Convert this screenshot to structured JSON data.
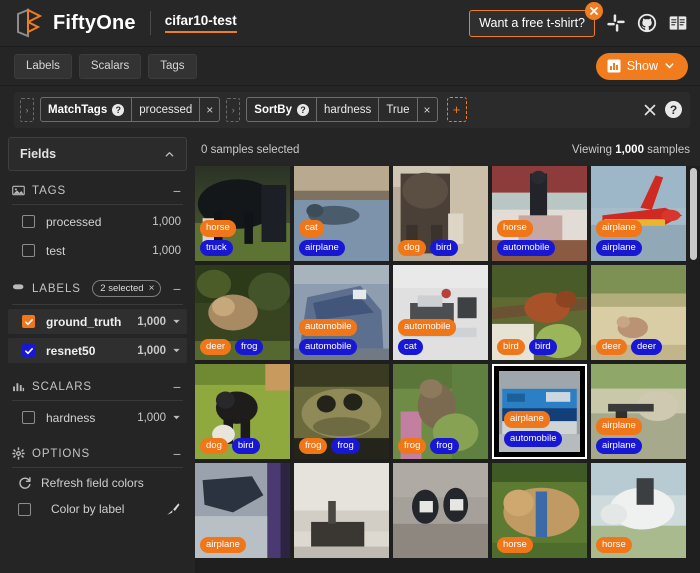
{
  "header": {
    "brand": "FiftyOne",
    "dataset_name": "cifar10-test",
    "tshirt_label": "Want a free t-shirt?",
    "icons": [
      "slack-icon",
      "github-icon",
      "docs-icon"
    ]
  },
  "tabs": [
    {
      "label": "Labels"
    },
    {
      "label": "Scalars"
    },
    {
      "label": "Tags"
    }
  ],
  "show_button": {
    "label": "Show"
  },
  "viewbar": {
    "stages": [
      {
        "name": "MatchTags",
        "help": "?",
        "parts": [
          "processed"
        ],
        "close": "×"
      },
      {
        "name": "SortBy",
        "help": "?",
        "parts": [
          "hardness",
          "True"
        ],
        "close": "×"
      }
    ],
    "add_label": "+",
    "clear_label": "×",
    "help_label": "?"
  },
  "sidebar": {
    "fields_label": "Fields",
    "sections": [
      {
        "name": "TAGS",
        "icon": "tags-icon",
        "collapse": "−",
        "items": [
          {
            "label": "processed",
            "count": "1,000",
            "checked": false,
            "color": "none",
            "caret": false
          },
          {
            "label": "test",
            "count": "1,000",
            "checked": false,
            "color": "none",
            "caret": false
          }
        ]
      },
      {
        "name": "LABELS",
        "icon": "labels-icon",
        "badge": "2 selected",
        "badge_close": "×",
        "collapse": "−",
        "items": [
          {
            "label": "ground_truth",
            "count": "1,000",
            "checked": true,
            "color": "orange",
            "caret": true
          },
          {
            "label": "resnet50",
            "count": "1,000",
            "checked": true,
            "color": "blue",
            "caret": true
          }
        ]
      },
      {
        "name": "SCALARS",
        "icon": "scalars-icon",
        "collapse": "−",
        "items": [
          {
            "label": "hardness",
            "count": "1,000",
            "checked": false,
            "color": "none",
            "caret": true
          }
        ]
      },
      {
        "name": "OPTIONS",
        "icon": "gear-icon",
        "collapse": "−",
        "options": [
          {
            "label": "Refresh field colors",
            "icon": "refresh-icon",
            "checkbox": false
          },
          {
            "label": "Color by label",
            "icon": "none",
            "checkbox": true,
            "trailing_icon": "brush-icon"
          }
        ]
      }
    ]
  },
  "samples_bar": {
    "selected_text": "0 samples selected",
    "viewing_prefix": "Viewing ",
    "viewing_count": "1,000",
    "viewing_suffix": " samples"
  },
  "colors": {
    "ground_truth": "#f0761a",
    "prediction": "#1818d4",
    "accent": "#ef7d22",
    "background": "#252525",
    "grid_background": "#1f1f1f"
  },
  "grid": {
    "columns": 5,
    "cells": [
      {
        "id": "r1c1",
        "gt": "horse",
        "pred": "truck",
        "layout": "stack",
        "selected": false,
        "img": {
          "base": "#2c3328",
          "style": "horse-dark"
        }
      },
      {
        "id": "r1c2",
        "gt": "cat",
        "pred": "airplane",
        "layout": "stack",
        "selected": false,
        "img": {
          "base": "#8d9fb2",
          "style": "cat-water"
        }
      },
      {
        "id": "r1c3",
        "gt": "dog",
        "pred": "bird",
        "layout": "row",
        "selected": false,
        "img": {
          "base": "#8a7b6c",
          "style": "dog-brown"
        }
      },
      {
        "id": "r1c4",
        "gt": "horse",
        "pred": "automobile",
        "layout": "stack",
        "selected": false,
        "img": {
          "base": "#b5aeb0",
          "style": "horse-rider"
        }
      },
      {
        "id": "r1c5",
        "gt": "airplane",
        "pred": "airplane",
        "layout": "stack",
        "selected": false,
        "img": {
          "base": "#9fb6c8",
          "style": "airplane-red"
        }
      },
      {
        "id": "r2c1",
        "gt": "deer",
        "pred": "frog",
        "layout": "row",
        "selected": false,
        "img": {
          "base": "#3c4a2a",
          "style": "deer-forest"
        }
      },
      {
        "id": "r2c2",
        "gt": "automobile",
        "pred": "automobile",
        "layout": "stack",
        "selected": false,
        "img": {
          "base": "#8796a8",
          "style": "car-blue"
        }
      },
      {
        "id": "r2c3",
        "gt": "automobile",
        "pred": "cat",
        "layout": "stack",
        "selected": false,
        "img": {
          "base": "#dcdcdc",
          "style": "car-white"
        }
      },
      {
        "id": "r2c4",
        "gt": "bird",
        "pred": "bird",
        "layout": "row",
        "selected": false,
        "img": {
          "base": "#6f6a3c",
          "style": "bird-branch"
        }
      },
      {
        "id": "r2c5",
        "gt": "deer",
        "pred": "deer",
        "layout": "row",
        "selected": false,
        "img": {
          "base": "#c9bc94",
          "style": "deer-field"
        }
      },
      {
        "id": "r3c1",
        "gt": "dog",
        "pred": "bird",
        "layout": "row",
        "selected": false,
        "img": {
          "base": "#8aa33f",
          "style": "dog-grass"
        }
      },
      {
        "id": "r3c2",
        "gt": "frog",
        "pred": "frog",
        "layout": "row",
        "selected": false,
        "img": {
          "base": "#6d6b3e",
          "style": "frog-dark"
        }
      },
      {
        "id": "r3c3",
        "gt": "frog",
        "pred": "frog",
        "layout": "row",
        "selected": false,
        "img": {
          "base": "#6f8a46",
          "style": "frog-green"
        }
      },
      {
        "id": "r3c4",
        "gt": "airplane",
        "pred": "automobile",
        "layout": "stack",
        "selected": true,
        "img": {
          "base": "#9aa2a8",
          "style": "train-blue"
        }
      },
      {
        "id": "r3c5",
        "gt": "airplane",
        "pred": "airplane",
        "layout": "stack",
        "selected": false,
        "img": {
          "base": "#b8b89a",
          "style": "plane-ground"
        }
      },
      {
        "id": "r4c1",
        "gt": "airplane",
        "pred": "",
        "layout": "stack",
        "selected": false,
        "img": {
          "base": "#9fa8b6",
          "style": "plane-dark"
        }
      },
      {
        "id": "r4c2",
        "gt": "",
        "pred": "",
        "layout": "row",
        "selected": false,
        "img": {
          "base": "#d8d5cc",
          "style": "ship-white"
        }
      },
      {
        "id": "r4c3",
        "gt": "",
        "pred": "",
        "layout": "row",
        "selected": false,
        "img": {
          "base": "#a09a92",
          "style": "bird-rock"
        }
      },
      {
        "id": "r4c4",
        "gt": "horse",
        "pred": "",
        "layout": "stack",
        "selected": false,
        "img": {
          "base": "#5d7a33",
          "style": "horse-green"
        }
      },
      {
        "id": "r4c5",
        "gt": "horse",
        "pred": "",
        "layout": "stack",
        "selected": false,
        "img": {
          "base": "#c9d6d8",
          "style": "horse-white"
        }
      }
    ]
  }
}
